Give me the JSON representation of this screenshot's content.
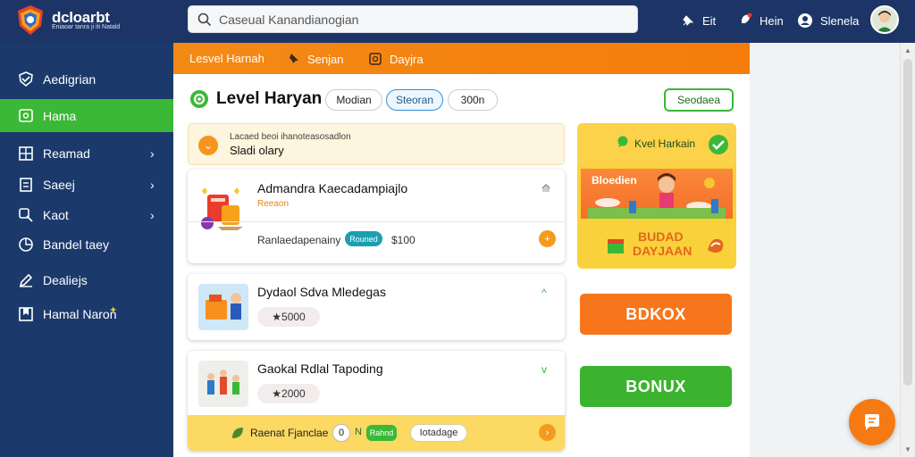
{
  "header": {
    "brand": "dcloarbt",
    "brand_sub": "Eniaoar tanra ji iti Natald",
    "search_placeholder": "Caseual Kanandianogian",
    "actions": [
      {
        "label": "Eit",
        "icon": "pin-icon"
      },
      {
        "label": "Hein",
        "icon": "rocket-icon"
      },
      {
        "label": "Slenela",
        "icon": "user-icon"
      }
    ]
  },
  "sidebar": {
    "items": [
      {
        "label": "Aedigrian",
        "icon": "shield-icon"
      },
      {
        "label": "Hama",
        "icon": "chat-icon",
        "active": true
      },
      {
        "label": "Reamad",
        "icon": "grid-icon",
        "chevron": "›"
      },
      {
        "label": "Saeej",
        "icon": "document-icon",
        "chevron": "›"
      },
      {
        "label": "Kaot",
        "icon": "search-icon",
        "chevron": "›"
      },
      {
        "label": "Bandel taey",
        "icon": "chart-icon"
      },
      {
        "label": "Dealiejs",
        "icon": "edit-icon"
      },
      {
        "label": "Hamal Naron",
        "icon": "bookmark-icon",
        "badge": "✦"
      }
    ]
  },
  "toolbar": {
    "items": [
      {
        "label": "Lesvel Harnah"
      },
      {
        "label": "Senjan",
        "icon": "pin-icon"
      },
      {
        "label": "Dayjra",
        "icon": "gift-icon"
      }
    ]
  },
  "main": {
    "title": "Level Haryan",
    "filters": [
      "Modian",
      "Steoran",
      "300n"
    ],
    "action_label": "Seodaea",
    "notice": {
      "line1": "Lacaed beoi ihanoteasosadlon",
      "line2": "Sladi olary"
    },
    "cards": [
      {
        "title": "Admandra Kaecadampiajlo",
        "sub": "Reeaon",
        "footer_text": "Ranlaedapenainy",
        "footer_tag": "Rouned",
        "footer_value": "$100",
        "footer_icon_label": "+"
      },
      {
        "title": "Dydaol Sdva Mledegas",
        "price": "★5000",
        "chevron": "^"
      },
      {
        "title": "Gaokal Rdlal Tapoding",
        "price": "★2000",
        "chevron": "v",
        "strip_text": "Raenat Fjanclae",
        "strip_count": "0",
        "strip_mid_icon": "N",
        "strip_tag": "Rahnd",
        "strip_pill": "Iotadage"
      }
    ]
  },
  "promo": {
    "header": "Kvel Harkain",
    "scene_title": "Bloedien",
    "line1": "BUDAD",
    "line2": "DAYJAAN"
  },
  "buttons": {
    "orange": "BDKOX",
    "green": "BONUX"
  },
  "colors": {
    "accent_green": "#3bb837",
    "accent_orange": "#f57c0a",
    "navy": "#1b3a6b"
  }
}
